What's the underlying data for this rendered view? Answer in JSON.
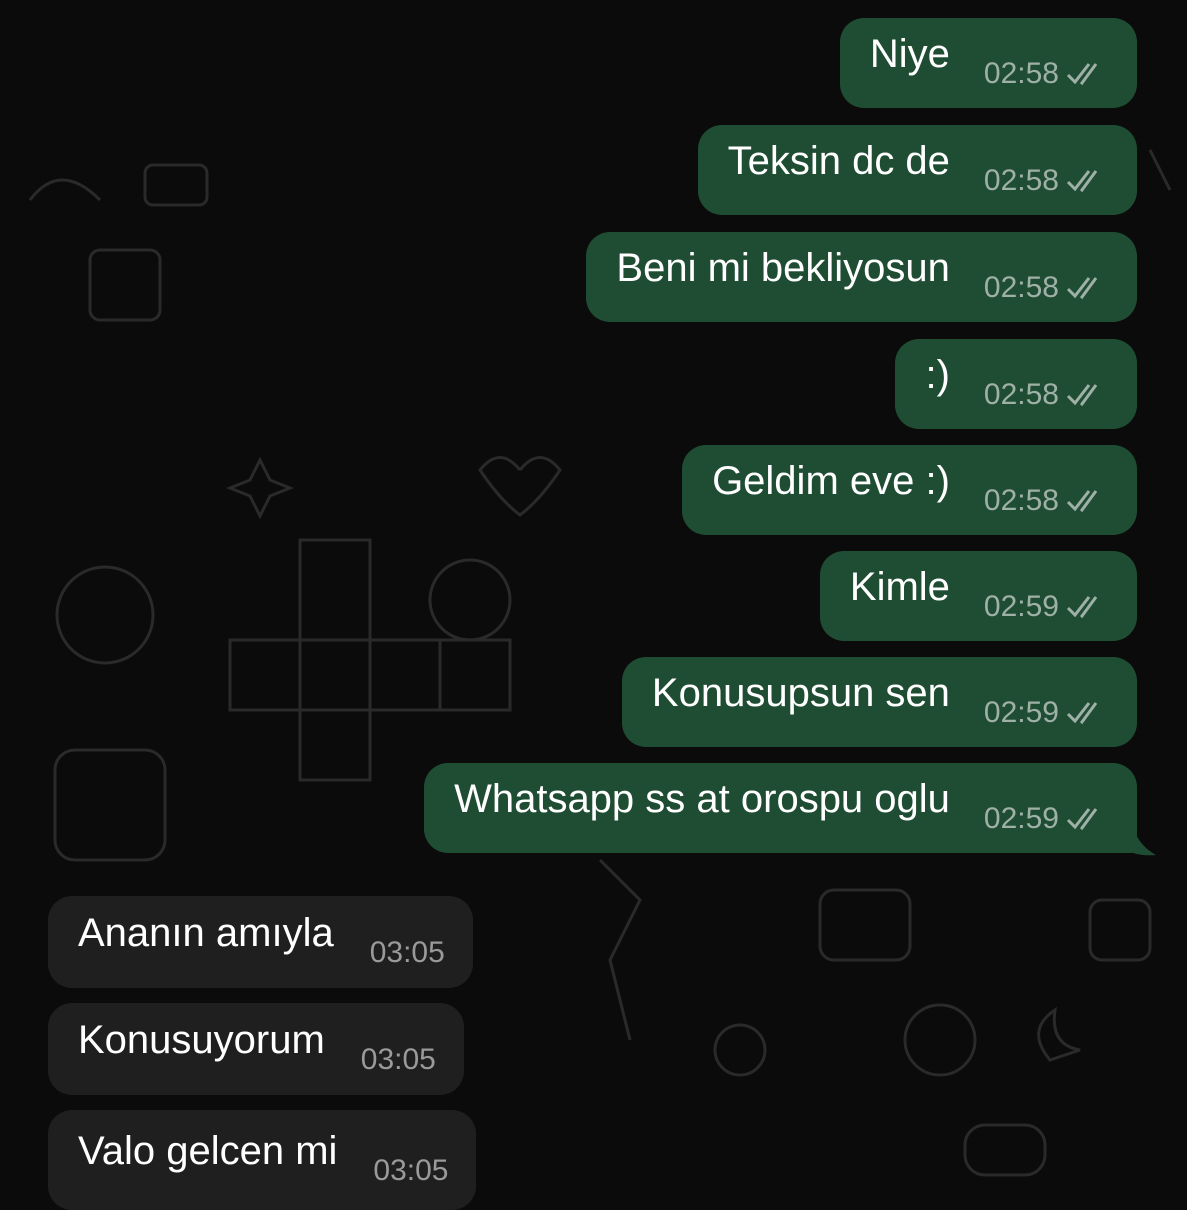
{
  "chat": {
    "outgoing": [
      {
        "text": "Niye",
        "time": "02:58"
      },
      {
        "text": "Teksin dc de",
        "time": "02:58"
      },
      {
        "text": "Beni mi bekliyosun",
        "time": "02:58"
      },
      {
        "text": ":)",
        "time": "02:58"
      },
      {
        "text": "Geldim eve :)",
        "time": "02:58"
      },
      {
        "text": "Kimle",
        "time": "02:59"
      },
      {
        "text": "Konusupsun sen",
        "time": "02:59"
      },
      {
        "text": "Whatsapp ss at orospu oglu",
        "time": "02:59"
      }
    ],
    "incoming": [
      {
        "text": "Ananın amıyla",
        "time": "03:05"
      },
      {
        "text": "Konusuyorum",
        "time": "03:05"
      },
      {
        "text": "Valo gelcen mi",
        "time": "03:05"
      }
    ]
  },
  "icons": {
    "read_receipt": "double-check-icon",
    "wallpaper": "doodle-pattern"
  },
  "colors": {
    "background": "#0b0b0b",
    "outgoing_bubble": "#1f4d33",
    "incoming_bubble": "#1f1f1f",
    "text": "#ffffff",
    "timestamp": "#9fb0a6"
  }
}
